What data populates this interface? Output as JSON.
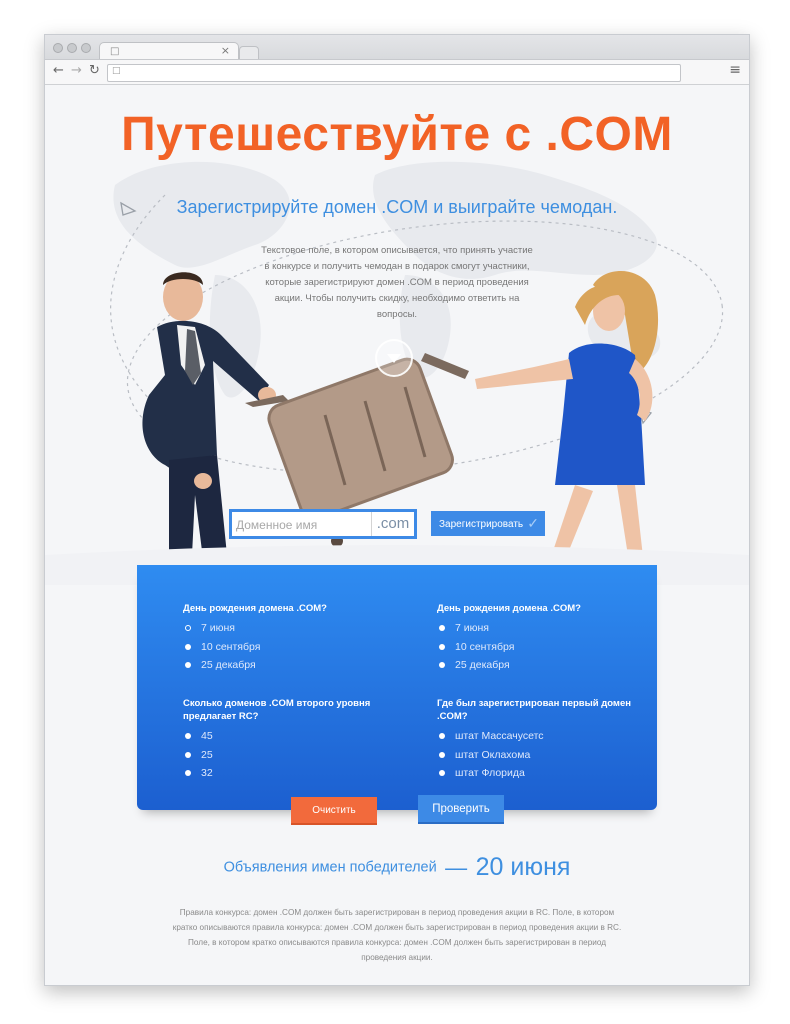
{
  "hero": {
    "title": "Путешествуйте с .COM",
    "subtitle": "Зарегистрируйте домен .COM и выиграйте чемодан.",
    "description": "Текстовое поле, в котором описывается, что принять участие в конкурсе и получить чемодан в подарок смогут участники, которые зарегистрируют домен .COM в период проведения акции. Чтобы получить скидку, необходимо ответить на вопросы."
  },
  "domain_form": {
    "placeholder": "Доменное имя",
    "suffix": ".com",
    "register_label": "Зарегистрировать"
  },
  "quiz": {
    "questions": [
      {
        "title": "День рождения домена .COM?",
        "options": [
          "7 июня",
          "10 сентября",
          "25 декабря"
        ],
        "selected": 0
      },
      {
        "title": "День рождения домена .COM?",
        "options": [
          "7 июня",
          "10 сентября",
          "25 декабря"
        ]
      },
      {
        "title": "Сколько доменов .COM второго уровня предлагает RC?",
        "options": [
          "45",
          "25",
          "32"
        ]
      },
      {
        "title": "Где был зарегистрирован первый домен .COM?",
        "options": [
          "штат Массачусетс",
          "штат Оклахома",
          "штат Флорида"
        ]
      }
    ],
    "clear_label": "Очистить",
    "check_label": "Проверить"
  },
  "winners": {
    "prefix": "Объявления имен победителей",
    "dash": "—",
    "date": "20 июня"
  },
  "rules": "Правила конкурса: домен .COM должен быть зарегистрирован в период проведения акции в RC. Поле, в котором кратко описываются правила конкурса: домен .COM должен быть зарегистрирован в период проведения акции в RC. Поле, в котором кратко описываются правила конкурса: домен .COM должен быть зарегистрирован в период проведения акции.",
  "colors": {
    "accent_orange": "#f26226",
    "accent_blue": "#3d8ae6",
    "quiz_top": "#2f8cf1",
    "quiz_bottom": "#1c5fd0"
  },
  "icons": {
    "tab": "document-icon",
    "back": "back-arrow-icon",
    "forward": "forward-arrow-icon",
    "reload": "reload-icon",
    "menu": "hamburger-menu-icon",
    "play": "play-down-icon",
    "register": "checkmark-icon"
  }
}
